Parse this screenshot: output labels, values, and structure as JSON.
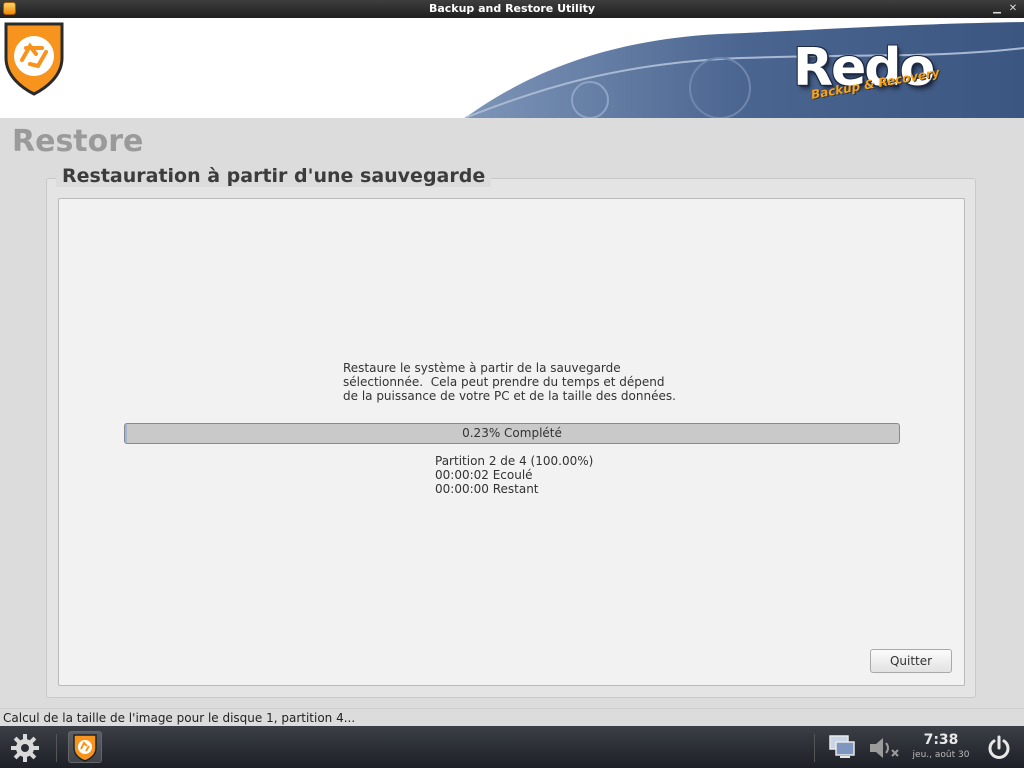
{
  "window": {
    "title": "Backup and Restore Utility",
    "minimize_glyph": "▁",
    "close_glyph": "✕"
  },
  "banner": {
    "logo_text": "Redo",
    "logo_subtitle": "Backup & Recovery",
    "brand_color": "#f7941d",
    "wave_color": "#4a6590"
  },
  "page": {
    "title": "Restore",
    "group_title": "Restauration à partir d'une sauvegarde",
    "description": "Restaure le système à partir de la sauvegarde\nsélectionnée.  Cela peut prendre du temps et dépend\nde la puissance de votre PC et de la taille des données.",
    "progress": {
      "percent": 0.23,
      "label": "0.23% Complété"
    },
    "status": {
      "partition": "Partition 2 de 4 (100.00%)",
      "elapsed": "00:00:02 Ecoulé",
      "remaining": "00:00:00 Restant"
    },
    "quit_label": "Quitter"
  },
  "statusbar": {
    "text": "Calcul de la taille de l'image pour le disque 1, partition 4..."
  },
  "taskbar": {
    "time": "7:38",
    "date": "jeu., août 30",
    "icons": [
      "settings-gear-icon",
      "redo-app-icon",
      "network-icon",
      "volume-muted-icon",
      "power-icon"
    ]
  }
}
